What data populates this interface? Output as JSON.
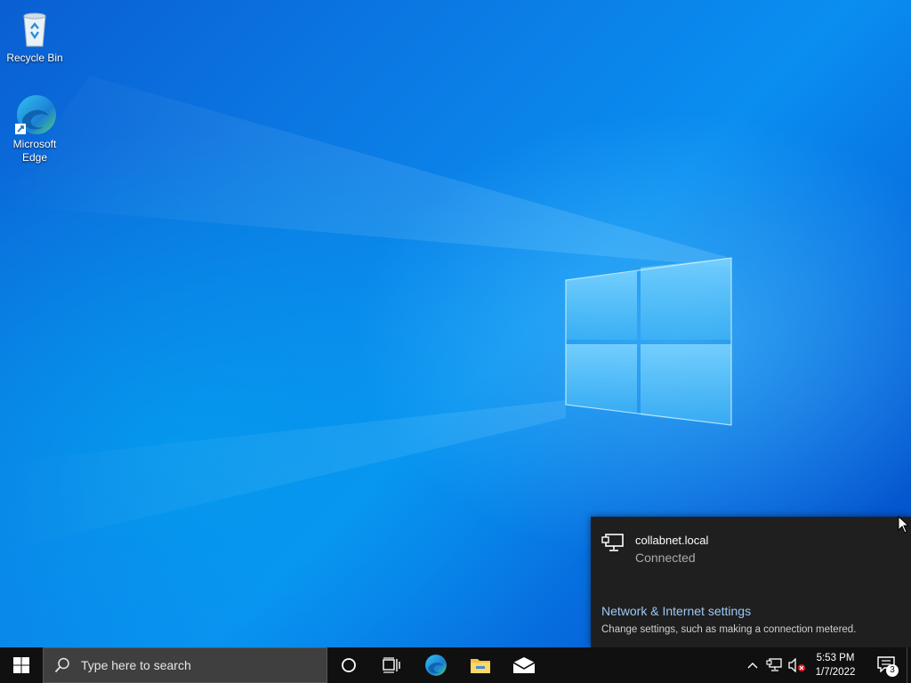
{
  "desktop": {
    "icons": [
      {
        "label": "Recycle Bin",
        "icon": "recycle-bin-icon"
      },
      {
        "label": "Microsoft Edge",
        "icon": "edge-icon"
      }
    ]
  },
  "network_flyout": {
    "network_name": "collabnet.local",
    "status": "Connected",
    "settings_link": "Network & Internet settings",
    "settings_description": "Change settings, such as making a connection metered."
  },
  "taskbar": {
    "search_placeholder": "Type here to search",
    "pinned": [
      "cortana-icon",
      "task-view-icon",
      "edge-icon",
      "file-explorer-icon",
      "mail-icon"
    ],
    "tray": {
      "time": "5:53 PM",
      "date": "1/7/2022",
      "notification_count": "3"
    }
  },
  "colors": {
    "accent_link": "#9ec8f4",
    "taskbar": "#101010",
    "flyout": "#1f1f1f"
  }
}
